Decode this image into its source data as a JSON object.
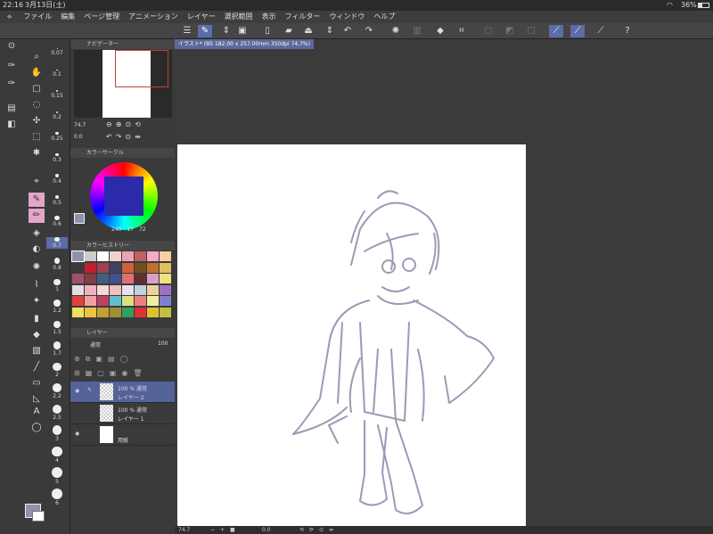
{
  "status": {
    "time": "22:16",
    "date": "3月13日(土)",
    "battery": "36%"
  },
  "menu": [
    "ファイル",
    "編集",
    "ページ管理",
    "アニメーション",
    "レイヤー",
    "選択範囲",
    "表示",
    "フィルター",
    "ウィンドウ",
    "ヘルプ"
  ],
  "document": {
    "tab_label": "イラスト* (B5 182.00 x 257.00mm 350dpi 74.7%)"
  },
  "navigator": {
    "title": "ナビゲーター",
    "zoom": "74.7",
    "angle": "0.0"
  },
  "color_circle": {
    "title": "カラーサークル",
    "h": "240",
    "s": "17",
    "v": "72"
  },
  "color_history": {
    "title": "カラーヒストリー"
  },
  "layer_panel": {
    "title": "レイヤー",
    "blend_mode": "通常",
    "opacity": "100"
  },
  "layers": [
    {
      "opacity": "100 %",
      "mode": "通常",
      "name": "レイヤー 2"
    },
    {
      "opacity": "100 %",
      "mode": "通常",
      "name": "レイヤー 1"
    },
    {
      "name": "用紙"
    }
  ],
  "brush_sizes": [
    "0.07",
    "0.1",
    "0.15",
    "0.2",
    "0.25",
    "0.3",
    "0.4",
    "0.5",
    "0.6",
    "0.7",
    "0.8",
    "1",
    "1.2",
    "1.5",
    "1.7",
    "2",
    "2.2",
    "2.5",
    "3",
    "4",
    "5",
    "6"
  ],
  "brush_selected": "0.7",
  "bottom": {
    "zoom": "74.7",
    "angle": "0.0"
  },
  "colors": {
    "accent": "#5b6ca8",
    "sketch": "#9a9bb5",
    "pen": "#e3a6c7"
  }
}
